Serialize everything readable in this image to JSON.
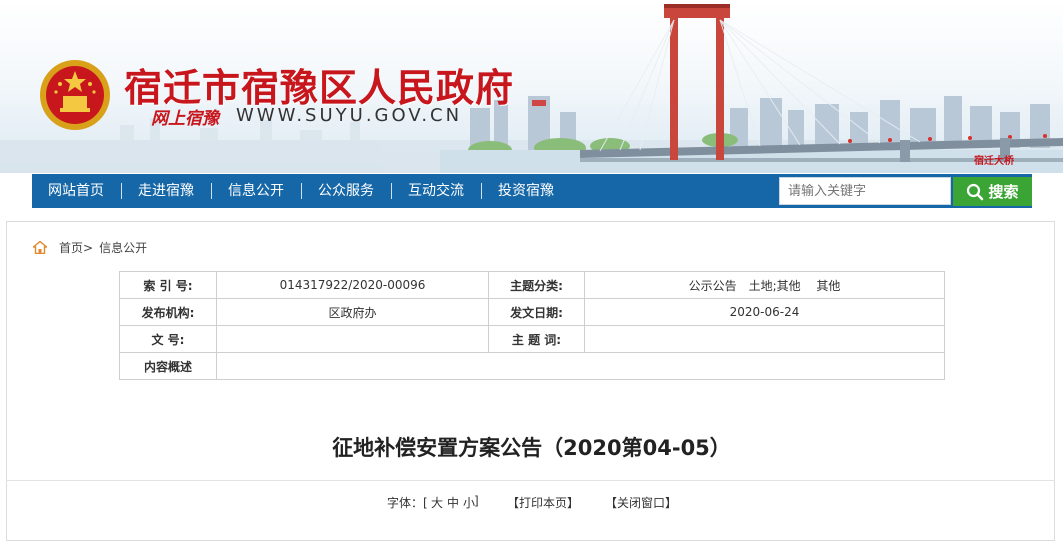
{
  "header": {
    "site_title": "宿迁市宿豫区人民政府",
    "slogan": "网上宿豫",
    "url": "WWW.SUYU.GOV.CN",
    "bridge_label": "宿迁大桥"
  },
  "nav": {
    "items": [
      {
        "label": "网站首页"
      },
      {
        "label": "走进宿豫"
      },
      {
        "label": "信息公开"
      },
      {
        "label": "公众服务"
      },
      {
        "label": "互动交流"
      },
      {
        "label": "投资宿豫"
      }
    ],
    "search_placeholder": "请输入关键字",
    "search_button": "搜索"
  },
  "breadcrumb": {
    "home": "首页>",
    "current": "信息公开"
  },
  "meta": {
    "rows": [
      {
        "k1": "索 引 号:",
        "v1": "014317922/2020-00096",
        "k2": "主题分类:",
        "v2": "公示公告　土地;其他　 其他"
      },
      {
        "k1": "发布机构:",
        "v1": "区政府办",
        "k2": "发文日期:",
        "v2": "2020-06-24"
      },
      {
        "k1": "文 号:",
        "v1": "",
        "k2": "主 题 词:",
        "v2": ""
      },
      {
        "k1": "内容概述",
        "v1": ""
      }
    ]
  },
  "article": {
    "title": "征地补偿安置方案公告（2020第04-05）"
  },
  "tools": {
    "font_label": "字体：[",
    "font_large": "大",
    "font_medium": "中",
    "font_small": "小",
    "font_close": "]",
    "print": "【打印本页】",
    "close": "【关闭窗口】"
  },
  "colors": {
    "brand_red": "#c8161d",
    "nav_blue": "#1567a8",
    "search_green": "#3aa535"
  }
}
